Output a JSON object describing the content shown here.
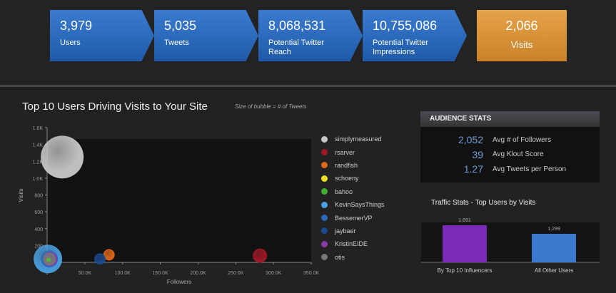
{
  "kpis": [
    {
      "value": "3,979",
      "label": "Users"
    },
    {
      "value": "5,035",
      "label": "Tweets"
    },
    {
      "value": "8,068,531",
      "label": "Potential Twitter Reach"
    },
    {
      "value": "10,755,086",
      "label": "Potential Twitter Impressions"
    }
  ],
  "visits": {
    "value": "2,066",
    "label": "Visits"
  },
  "chart_data": [
    {
      "type": "scatter",
      "title": "Top 10 Users Driving Visits to Your Site",
      "subtitle": "Size of bubble = # of Tweets",
      "xlabel": "Followers",
      "ylabel": "Visits",
      "xlim": [
        0,
        350000
      ],
      "ylim": [
        0,
        1600
      ],
      "xticks": [
        "0",
        "50.0K",
        "100.0K",
        "150.0K",
        "200.0K",
        "250.0K",
        "300.0K",
        "350.0K"
      ],
      "yticks": [
        "0",
        "200",
        "400",
        "600",
        "800",
        "1.0K",
        "1.2K",
        "1.4K",
        "1.6K"
      ],
      "legend": "right",
      "series": [
        {
          "name": "simplymeasured",
          "x": 20000,
          "y": 1250,
          "size": 30,
          "color": "#c8c8c8"
        },
        {
          "name": "rsarver",
          "x": 282000,
          "y": 80,
          "size": 10,
          "color": "#a01828"
        },
        {
          "name": "randfish",
          "x": 82000,
          "y": 90,
          "size": 8,
          "color": "#e06818"
        },
        {
          "name": "schoeny",
          "x": 2000,
          "y": 30,
          "size": 3,
          "color": "#e8e020"
        },
        {
          "name": "bahoo",
          "x": 2000,
          "y": 30,
          "size": 3,
          "color": "#40b030"
        },
        {
          "name": "KevinSaysThings",
          "x": 1000,
          "y": 40,
          "size": 20,
          "color": "#4aa0e0"
        },
        {
          "name": "BessemerVP",
          "x": 3000,
          "y": 40,
          "size": 12,
          "color": "#2a6ab8"
        },
        {
          "name": "jaybaer",
          "x": 70000,
          "y": 40,
          "size": 8,
          "color": "#1c4a90"
        },
        {
          "name": "KristinEIDE",
          "x": 4000,
          "y": 40,
          "size": 10,
          "color": "#8a3aa8"
        },
        {
          "name": "otis",
          "x": 3000,
          "y": 40,
          "size": 9,
          "color": "#777"
        }
      ]
    },
    {
      "type": "bar",
      "title": "Traffic Stats - Top Users by Visits",
      "categories": [
        "By Top 10 Influencers",
        "All Other Users"
      ],
      "values": [
        1691,
        1299
      ],
      "labels": [
        "1,691",
        "1,299"
      ],
      "colors": [
        "#7a2ab8",
        "#3a7bd0"
      ]
    }
  ],
  "audience": {
    "title": "AUDIENCE STATS",
    "rows": [
      {
        "value": "2,052",
        "label": "Avg # of Followers"
      },
      {
        "value": "39",
        "label": "Avg Klout Score"
      },
      {
        "value": "1.27",
        "label": "Avg Tweets per Person"
      }
    ]
  }
}
